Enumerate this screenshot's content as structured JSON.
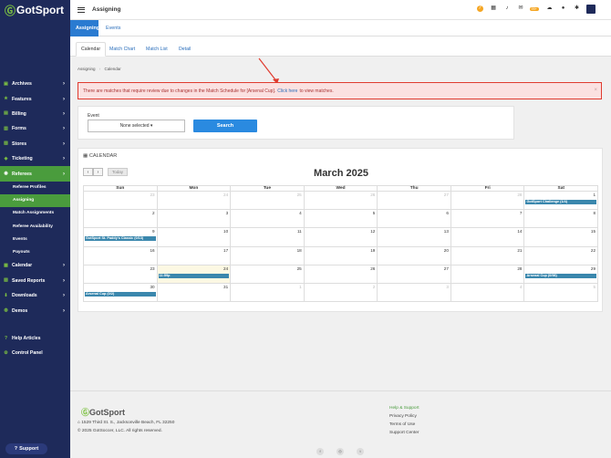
{
  "brand": {
    "name_a": "Got",
    "name_b": "Sport"
  },
  "header": {
    "title": "Assigning",
    "mail_badge": "99+"
  },
  "sidebar": {
    "items": [
      {
        "label": "Archives",
        "icon": "archive-icon"
      },
      {
        "label": "Features",
        "icon": "star-icon"
      },
      {
        "label": "Billing",
        "icon": "billing-icon"
      },
      {
        "label": "Forms",
        "icon": "forms-icon"
      },
      {
        "label": "Stores",
        "icon": "store-icon"
      },
      {
        "label": "Ticketing",
        "icon": "ticket-icon"
      },
      {
        "label": "Referees",
        "icon": "whistle-icon"
      }
    ],
    "sub_items": [
      "Referee Profiles",
      "Assigning",
      "Match Assignments",
      "Referee Availability",
      "Events",
      "Payouts"
    ],
    "items_after": [
      {
        "label": "Calendar",
        "icon": "calendar-icon"
      },
      {
        "label": "Saved Reports",
        "icon": "report-icon"
      },
      {
        "label": "Downloads",
        "icon": "download-icon"
      },
      {
        "label": "Demos",
        "icon": "demo-icon"
      }
    ],
    "bottom_items": [
      {
        "label": "Help Articles",
        "icon": "help-icon"
      },
      {
        "label": "Control Panel",
        "icon": "gear-icon"
      }
    ],
    "support_label": "Support"
  },
  "tabs": [
    "Assigning",
    "Events"
  ],
  "subtabs": [
    "Calendar",
    "Match Chart",
    "Match List",
    "Detail"
  ],
  "breadcrumb": {
    "root": "Assigning",
    "sep": "›",
    "current": "Calendar"
  },
  "alert": {
    "text_before": "There are matches that require review due to changes in the Match Schedule for [Arsenal Cup].",
    "link": "Click here",
    "text_after": "to view matches.",
    "close": "×"
  },
  "event_filter": {
    "label": "Event",
    "select_value": "None selected ▾",
    "search_label": "Search"
  },
  "calendar": {
    "header": "CALENDAR",
    "prev": "‹",
    "next": "›",
    "today": "Today",
    "title": "March 2025",
    "days": [
      "Sun",
      "Mon",
      "Tue",
      "Wed",
      "Thu",
      "Fri",
      "Sat"
    ],
    "weeks": [
      [
        {
          "n": "23",
          "o": true
        },
        {
          "n": "24",
          "o": true
        },
        {
          "n": "25",
          "o": true
        },
        {
          "n": "26",
          "o": true
        },
        {
          "n": "27",
          "o": true
        },
        {
          "n": "28",
          "o": true
        },
        {
          "n": "1",
          "ev": "GotSport Challenge (1/4)"
        }
      ],
      [
        {
          "n": "2"
        },
        {
          "n": "3"
        },
        {
          "n": "4"
        },
        {
          "n": "5"
        },
        {
          "n": "6"
        },
        {
          "n": "7"
        },
        {
          "n": "8"
        }
      ],
      [
        {
          "n": "9",
          "ev": "GotSport St. Paddy's Classic (0/13)"
        },
        {
          "n": "10"
        },
        {
          "n": "11"
        },
        {
          "n": "12"
        },
        {
          "n": "13"
        },
        {
          "n": "14"
        },
        {
          "n": "15"
        }
      ],
      [
        {
          "n": "16"
        },
        {
          "n": "17"
        },
        {
          "n": "18"
        },
        {
          "n": "19"
        },
        {
          "n": "20"
        },
        {
          "n": "21"
        },
        {
          "n": "22"
        }
      ],
      [
        {
          "n": "23"
        },
        {
          "n": "24",
          "today": true,
          "ev": "11:59p"
        },
        {
          "n": "25"
        },
        {
          "n": "26"
        },
        {
          "n": "27"
        },
        {
          "n": "28"
        },
        {
          "n": "29",
          "ev": "Arsenal Cup (0/98)"
        }
      ],
      [
        {
          "n": "30",
          "ev": "Arsenal Cup (0/2)"
        },
        {
          "n": "31"
        },
        {
          "n": "1",
          "o": true
        },
        {
          "n": "2",
          "o": true
        },
        {
          "n": "3",
          "o": true
        },
        {
          "n": "4",
          "o": true
        },
        {
          "n": "5",
          "o": true
        }
      ]
    ]
  },
  "footer": {
    "address": "1529 Third St. S., Jacksonville Beach, FL 32250",
    "copyright": "© 2025 GotSoccer, LLC. All rights reserved.",
    "links_heading": "Help & Support",
    "links": [
      "Privacy Policy",
      "Terms of Use",
      "Support Center"
    ],
    "social": [
      "f",
      "◎",
      "t"
    ]
  },
  "colors": {
    "sidebar": "#1e2a5a",
    "active_green": "#4a9c3d",
    "primary_blue": "#2a8ae0",
    "event_blue": "#3a87ad",
    "alert_red": "#e03b2f"
  }
}
